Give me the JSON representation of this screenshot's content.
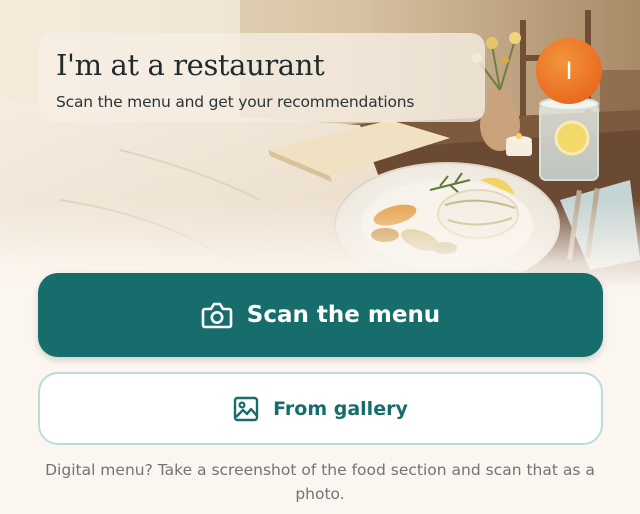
{
  "header": {
    "title": "I'm at a restaurant",
    "subtitle": "Scan the menu and get your recommendations"
  },
  "avatar": {
    "initial": "I",
    "color": "#ee7a26"
  },
  "actions": {
    "scan_label": "Scan the menu",
    "scan_icon": "camera-icon",
    "gallery_label": "From gallery",
    "gallery_icon": "image-icon"
  },
  "hint": {
    "text": "Digital menu? Take a screenshot of the food section and scan that as a photo."
  },
  "colors": {
    "primary": "#166d6b",
    "secondary_border": "#bcdcd9",
    "background": "#fbf6ef"
  }
}
